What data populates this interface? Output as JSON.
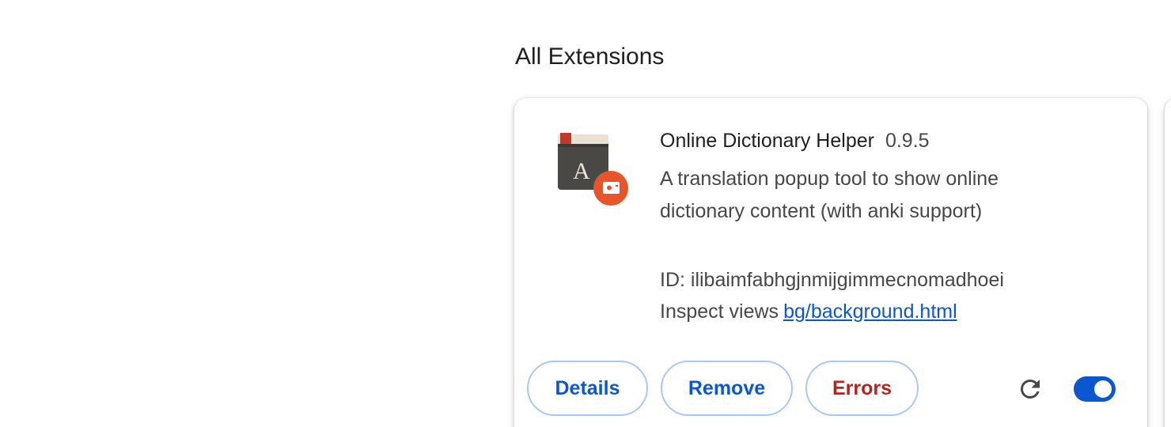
{
  "section": {
    "title": "All Extensions"
  },
  "extension": {
    "name": "Online Dictionary Helper",
    "version": "0.9.5",
    "description": "A translation popup tool to show online dictionary content (with anki support)",
    "id_label": "ID: ilibaimfabhgjnmijgimmecnomadhoei",
    "inspect_label": "Inspect views",
    "inspect_link": "bg/background.html",
    "icon": "dictionary-book-icon",
    "enabled": true
  },
  "actions": {
    "details_label": "Details",
    "remove_label": "Remove",
    "errors_label": "Errors",
    "reload_icon": "reload-icon"
  },
  "colors": {
    "accent": "#0b57d0",
    "error": "#b3261e",
    "button_border": "#a8c7fa",
    "badge": "#e8552a"
  }
}
